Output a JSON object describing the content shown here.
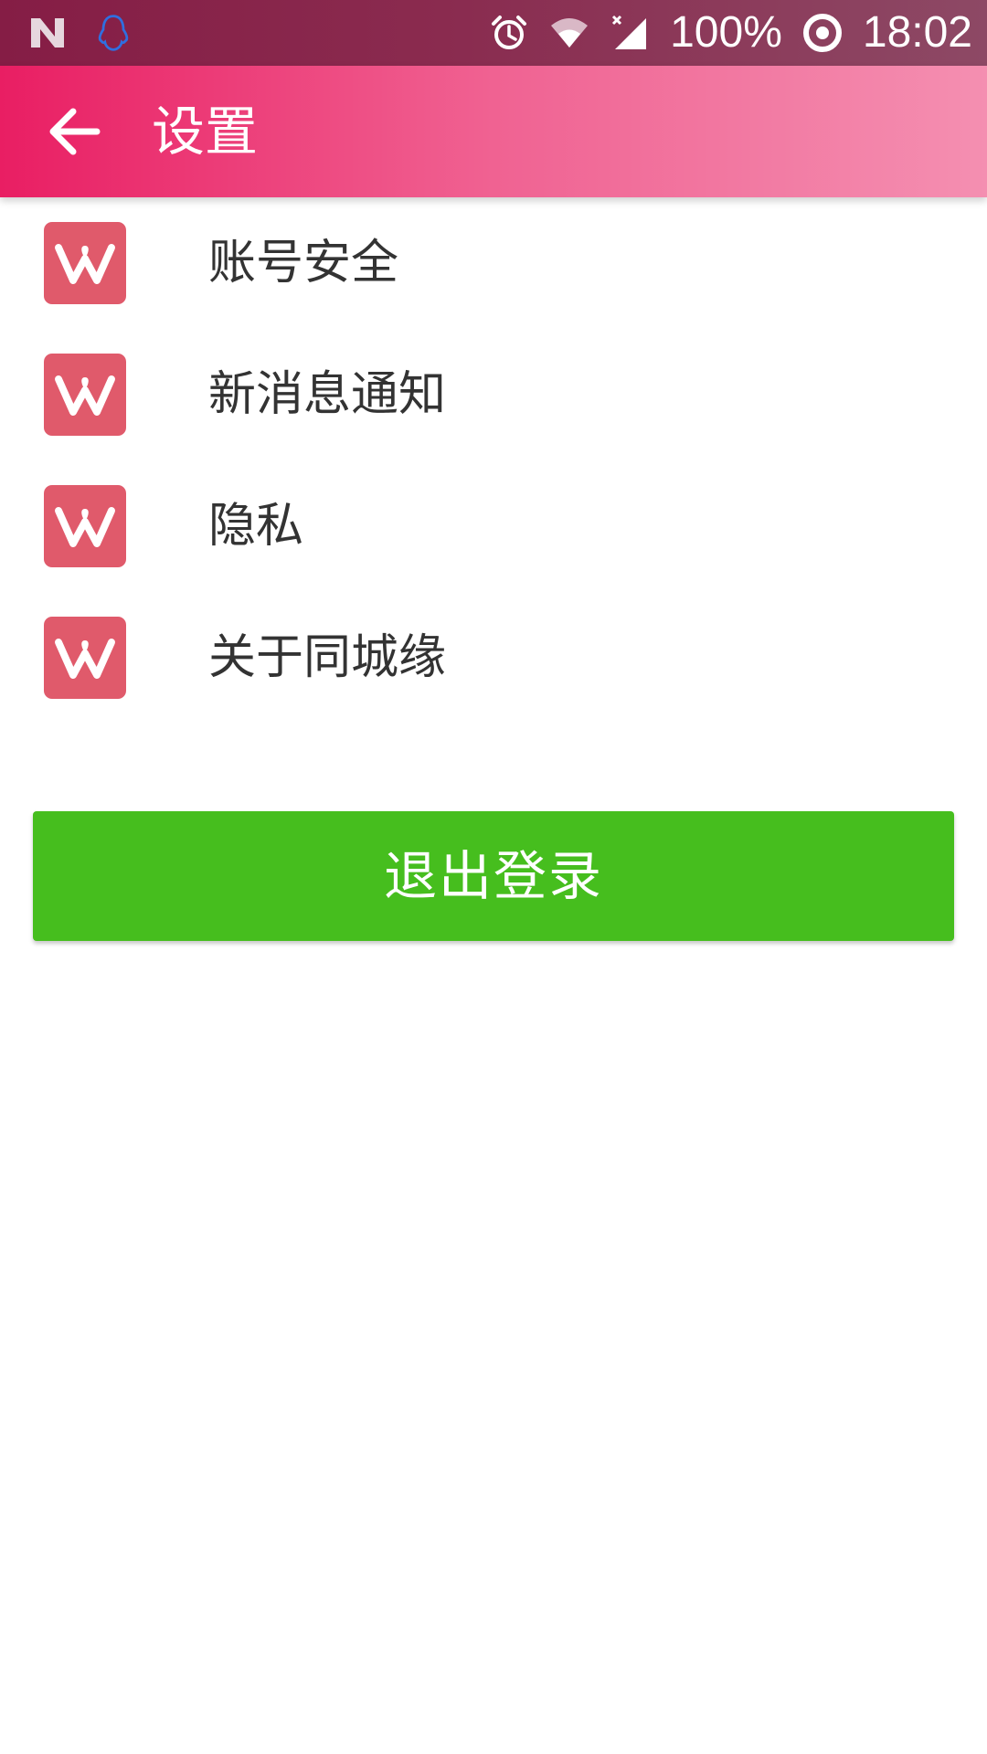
{
  "status_bar": {
    "left_icons": [
      "n-notification-icon",
      "qq-penguin-icon"
    ],
    "right_icons": [
      "alarm-icon",
      "wifi-icon",
      "signal-icon",
      "data-saver-icon"
    ],
    "battery": "100%",
    "time": "18:02"
  },
  "app_bar": {
    "back_icon": "arrow-left-icon",
    "title": "设置",
    "gradient": [
      "#e91e63",
      "#f48fb1"
    ]
  },
  "menu": {
    "items": [
      {
        "label": "账号安全",
        "icon": "app-logo-icon"
      },
      {
        "label": "新消息通知",
        "icon": "app-logo-icon"
      },
      {
        "label": "隐私",
        "icon": "app-logo-icon"
      },
      {
        "label": "关于同城缘",
        "icon": "app-logo-icon"
      }
    ]
  },
  "logout": {
    "label": "退出登录",
    "color": "#46be1e"
  },
  "colors": {
    "icon_bg": "#e05a6b",
    "text": "#333333"
  }
}
